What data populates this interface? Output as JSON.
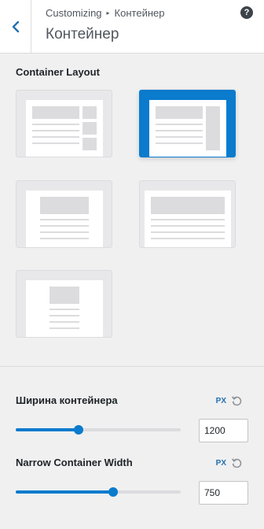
{
  "header": {
    "breadcrumb_root": "Customizing",
    "breadcrumb_separator": "▸",
    "breadcrumb_current": "Контейнер",
    "title": "Контейнер",
    "help_label": "?"
  },
  "layout": {
    "label": "Container Layout",
    "options": [
      {
        "id": "right-sidebar"
      },
      {
        "id": "right-sidebar-boxed",
        "selected": true
      },
      {
        "id": "full-width-boxed"
      },
      {
        "id": "full-width-wide"
      },
      {
        "id": "narrow"
      }
    ]
  },
  "container_width": {
    "label": "Ширина контейнера",
    "unit": "PX",
    "value": "1200",
    "percent": 0.38
  },
  "narrow_width": {
    "label": "Narrow Container Width",
    "unit": "PX",
    "value": "750",
    "percent": 0.59
  },
  "colors": {
    "accent": "#0b7bcd",
    "background": "#f0f0f1"
  },
  "icons": [
    "chevron-left-icon",
    "help-icon",
    "reset-icon"
  ]
}
